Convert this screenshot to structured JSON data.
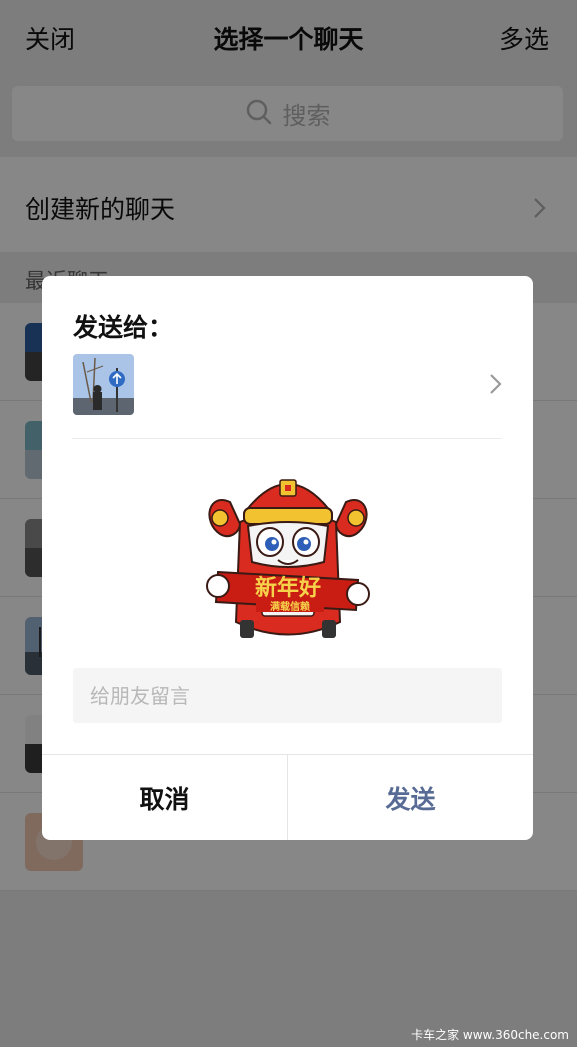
{
  "header": {
    "close_label": "关闭",
    "title": "选择一个聊天",
    "multi_select_label": "多选"
  },
  "search": {
    "placeholder": "搜索",
    "icon": "search-icon"
  },
  "new_chat": {
    "label": "创建新的聊天",
    "icon": "chevron-right-icon"
  },
  "recent": {
    "section_label": "最近聊天"
  },
  "dialog": {
    "title": "发送给：",
    "recipient_icon": "chevron-right-icon",
    "sticker": {
      "banner_text": "新年好",
      "small_text": "满载信赖"
    },
    "message_placeholder": "给朋友留言",
    "cancel_label": "取消",
    "send_label": "发送"
  },
  "watermark": "卡车之家 www.360che.com",
  "colors": {
    "send_button": "#576b95",
    "background": "#ededed",
    "mask": "rgba(0,0,0,0.47)"
  }
}
